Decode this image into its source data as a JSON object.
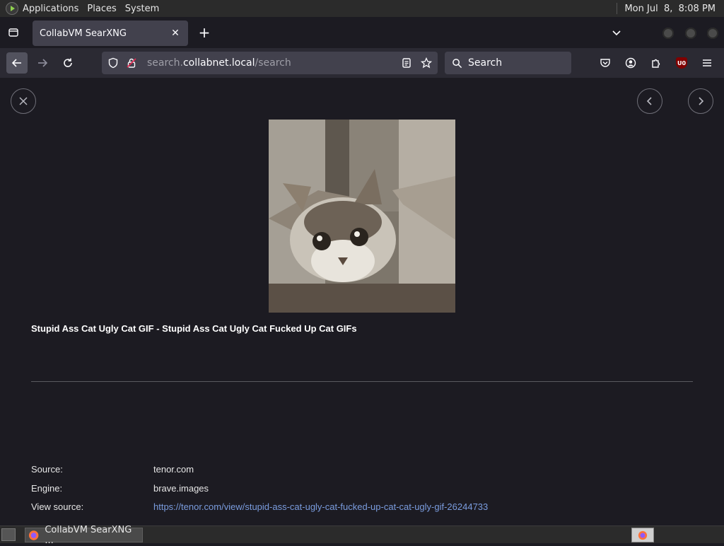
{
  "panel": {
    "menus": [
      "Applications",
      "Places",
      "System"
    ],
    "clock": "Mon Jul  8,  8:08 PM"
  },
  "browser": {
    "tab_title": "CollabVM SearXNG",
    "url": {
      "prefix": "search.",
      "host": "collabnet.local",
      "path": "/search"
    },
    "search_placeholder": "Search",
    "ublock_badge": "U0"
  },
  "viewer": {
    "title": "Stupid Ass Cat Ugly Cat GIF - Stupid Ass Cat Ugly Cat Fucked Up Cat GIFs",
    "details": [
      {
        "key": "Source:",
        "value": "tenor.com",
        "link": false
      },
      {
        "key": "Engine:",
        "value": "brave.images",
        "link": false
      },
      {
        "key": "View source:",
        "value": "https://tenor.com/view/stupid-ass-cat-ugly-cat-fucked-up-cat-cat-ugly-gif-26244733",
        "link": true
      }
    ]
  },
  "taskbar": {
    "item_label": "CollabVM SearXNG ..."
  },
  "colors": {
    "background": "#1c1b22",
    "toolbar": "#2b2a33",
    "field": "#42414d",
    "link": "#7a9cde",
    "panel": "#2b2b2b"
  },
  "icons": [
    "apps-logo-icon",
    "tab-list-icon",
    "close-icon",
    "plus-icon",
    "chevron-down-icon",
    "back-arrow-icon",
    "forward-arrow-icon",
    "reload-icon",
    "shield-icon",
    "lock-icon",
    "reader-view-icon",
    "star-icon",
    "search-icon",
    "pocket-icon",
    "account-icon",
    "extensions-icon",
    "ublock-icon",
    "hamburger-menu-icon",
    "chevron-left-icon",
    "chevron-right-icon",
    "firefox-icon"
  ]
}
